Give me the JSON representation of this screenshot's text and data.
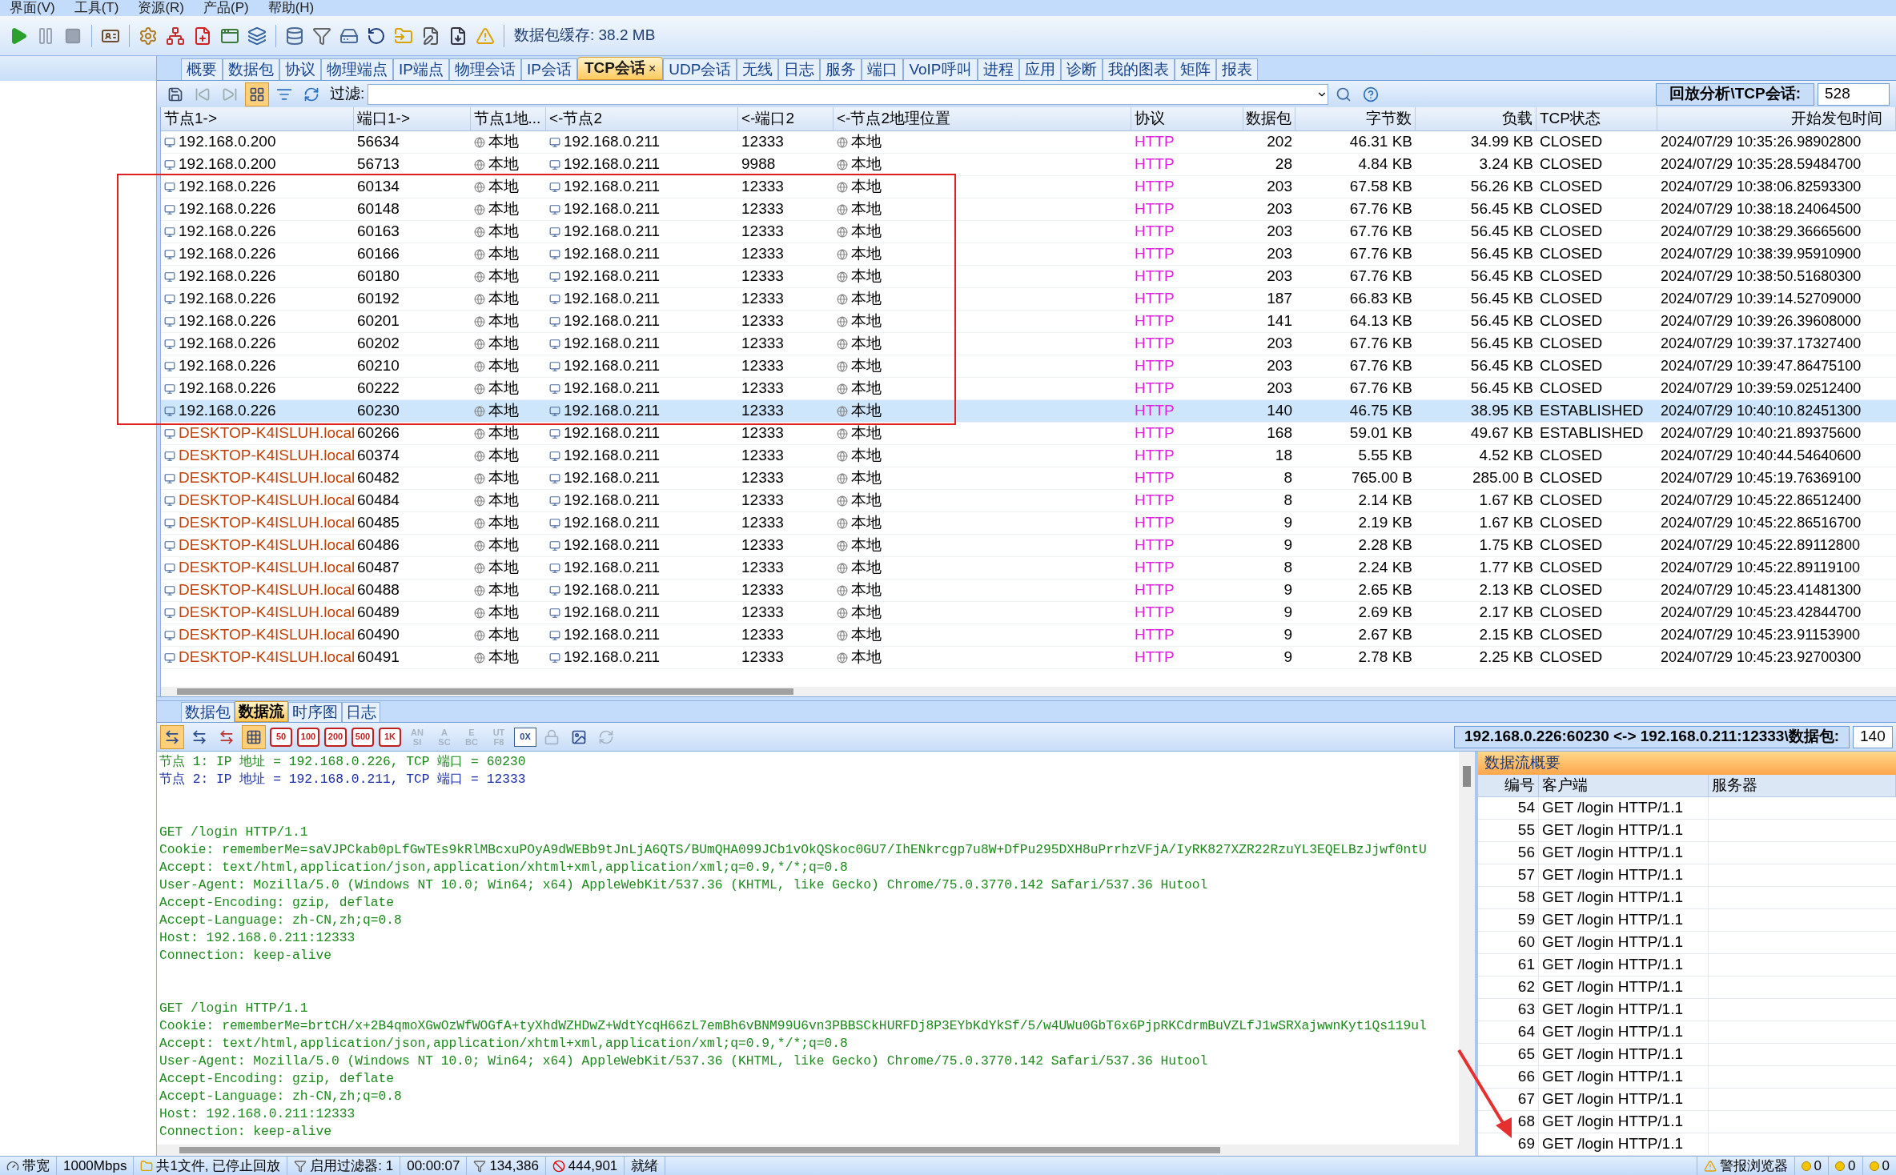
{
  "menu": [
    "界面(V)",
    "工具(T)",
    "资源(R)",
    "产品(P)",
    "帮助(H)"
  ],
  "toolbar": {
    "cache_label": "数据包缓存: 38.2 MB"
  },
  "tabs": [
    {
      "label": "概要",
      "selected": false
    },
    {
      "label": "数据包",
      "selected": false
    },
    {
      "label": "协议",
      "selected": false
    },
    {
      "label": "物理端点",
      "selected": false
    },
    {
      "label": "IP端点",
      "selected": false
    },
    {
      "label": "物理会话",
      "selected": false
    },
    {
      "label": "IP会话",
      "selected": false
    },
    {
      "label": "TCP会话",
      "selected": true,
      "close": "×"
    },
    {
      "label": "UDP会话",
      "selected": false
    },
    {
      "label": "无线",
      "selected": false
    },
    {
      "label": "日志",
      "selected": false
    },
    {
      "label": "服务",
      "selected": false
    },
    {
      "label": "端口",
      "selected": false
    },
    {
      "label": "VoIP呼叫",
      "selected": false
    },
    {
      "label": "进程",
      "selected": false
    },
    {
      "label": "应用",
      "selected": false
    },
    {
      "label": "诊断",
      "selected": false
    },
    {
      "label": "我的图表",
      "selected": false
    },
    {
      "label": "矩阵",
      "selected": false
    },
    {
      "label": "报表",
      "selected": false
    }
  ],
  "filter_bar": {
    "label": "过滤:",
    "path": "回放分析\\TCP会话:",
    "count": "528"
  },
  "table": {
    "columns": [
      "节点1->",
      "端口1->",
      "节点1地...",
      "<-节点2",
      "<-端口2",
      "<-节点2地理位置",
      "协议",
      "数据包",
      "字节数",
      "负载",
      "TCP状态",
      "开始发包时间"
    ],
    "rows": [
      {
        "selected": false,
        "color": "#000000",
        "cells": [
          "192.168.0.200",
          "56634",
          "本地",
          "192.168.0.211",
          "12333",
          "本地",
          "HTTP",
          "202",
          "46.31 KB",
          "34.99 KB",
          "CLOSED",
          "2024/07/29 10:35:26.98902800"
        ]
      },
      {
        "selected": false,
        "color": "#000000",
        "cells": [
          "192.168.0.200",
          "56713",
          "本地",
          "192.168.0.211",
          "9988",
          "本地",
          "HTTP",
          "28",
          "4.84 KB",
          "3.24 KB",
          "CLOSED",
          "2024/07/29 10:35:28.59484700"
        ]
      },
      {
        "selected": false,
        "color": "#000000",
        "cells": [
          "192.168.0.226",
          "60134",
          "本地",
          "192.168.0.211",
          "12333",
          "本地",
          "HTTP",
          "203",
          "67.58 KB",
          "56.26 KB",
          "CLOSED",
          "2024/07/29 10:38:06.82593300"
        ]
      },
      {
        "selected": false,
        "color": "#000000",
        "cells": [
          "192.168.0.226",
          "60148",
          "本地",
          "192.168.0.211",
          "12333",
          "本地",
          "HTTP",
          "203",
          "67.76 KB",
          "56.45 KB",
          "CLOSED",
          "2024/07/29 10:38:18.24064500"
        ]
      },
      {
        "selected": false,
        "color": "#000000",
        "cells": [
          "192.168.0.226",
          "60163",
          "本地",
          "192.168.0.211",
          "12333",
          "本地",
          "HTTP",
          "203",
          "67.76 KB",
          "56.45 KB",
          "CLOSED",
          "2024/07/29 10:38:29.36665600"
        ]
      },
      {
        "selected": false,
        "color": "#000000",
        "cells": [
          "192.168.0.226",
          "60166",
          "本地",
          "192.168.0.211",
          "12333",
          "本地",
          "HTTP",
          "203",
          "67.76 KB",
          "56.45 KB",
          "CLOSED",
          "2024/07/29 10:38:39.95910900"
        ]
      },
      {
        "selected": false,
        "color": "#000000",
        "cells": [
          "192.168.0.226",
          "60180",
          "本地",
          "192.168.0.211",
          "12333",
          "本地",
          "HTTP",
          "203",
          "67.76 KB",
          "56.45 KB",
          "CLOSED",
          "2024/07/29 10:38:50.51680300"
        ]
      },
      {
        "selected": false,
        "color": "#000000",
        "cells": [
          "192.168.0.226",
          "60192",
          "本地",
          "192.168.0.211",
          "12333",
          "本地",
          "HTTP",
          "187",
          "66.83 KB",
          "56.45 KB",
          "CLOSED",
          "2024/07/29 10:39:14.52709000"
        ]
      },
      {
        "selected": false,
        "color": "#000000",
        "cells": [
          "192.168.0.226",
          "60201",
          "本地",
          "192.168.0.211",
          "12333",
          "本地",
          "HTTP",
          "141",
          "64.13 KB",
          "56.45 KB",
          "CLOSED",
          "2024/07/29 10:39:26.39608000"
        ]
      },
      {
        "selected": false,
        "color": "#000000",
        "cells": [
          "192.168.0.226",
          "60202",
          "本地",
          "192.168.0.211",
          "12333",
          "本地",
          "HTTP",
          "203",
          "67.76 KB",
          "56.45 KB",
          "CLOSED",
          "2024/07/29 10:39:37.17327400"
        ]
      },
      {
        "selected": false,
        "color": "#000000",
        "cells": [
          "192.168.0.226",
          "60210",
          "本地",
          "192.168.0.211",
          "12333",
          "本地",
          "HTTP",
          "203",
          "67.76 KB",
          "56.45 KB",
          "CLOSED",
          "2024/07/29 10:39:47.86475100"
        ]
      },
      {
        "selected": false,
        "color": "#000000",
        "cells": [
          "192.168.0.226",
          "60222",
          "本地",
          "192.168.0.211",
          "12333",
          "本地",
          "HTTP",
          "203",
          "67.76 KB",
          "56.45 KB",
          "CLOSED",
          "2024/07/29 10:39:59.02512400"
        ]
      },
      {
        "selected": true,
        "color": "#000000",
        "cells": [
          "192.168.0.226",
          "60230",
          "本地",
          "192.168.0.211",
          "12333",
          "本地",
          "HTTP",
          "140",
          "46.75 KB",
          "38.95 KB",
          "ESTABLISHED",
          "2024/07/29 10:40:10.82451300"
        ]
      },
      {
        "selected": false,
        "color": "#c0400a",
        "cells": [
          "DESKTOP-K4ISLUH.local",
          "60266",
          "本地",
          "192.168.0.211",
          "12333",
          "本地",
          "HTTP",
          "168",
          "59.01 KB",
          "49.67 KB",
          "ESTABLISHED",
          "2024/07/29 10:40:21.89375600"
        ]
      },
      {
        "selected": false,
        "color": "#c0400a",
        "cells": [
          "DESKTOP-K4ISLUH.local",
          "60374",
          "本地",
          "192.168.0.211",
          "12333",
          "本地",
          "HTTP",
          "18",
          "5.55 KB",
          "4.52 KB",
          "CLOSED",
          "2024/07/29 10:40:44.54640600"
        ]
      },
      {
        "selected": false,
        "color": "#c0400a",
        "cells": [
          "DESKTOP-K4ISLUH.local",
          "60482",
          "本地",
          "192.168.0.211",
          "12333",
          "本地",
          "HTTP",
          "8",
          "765.00 B",
          "285.00 B",
          "CLOSED",
          "2024/07/29 10:45:19.76369100"
        ]
      },
      {
        "selected": false,
        "color": "#c0400a",
        "cells": [
          "DESKTOP-K4ISLUH.local",
          "60484",
          "本地",
          "192.168.0.211",
          "12333",
          "本地",
          "HTTP",
          "8",
          "2.14 KB",
          "1.67 KB",
          "CLOSED",
          "2024/07/29 10:45:22.86512400"
        ]
      },
      {
        "selected": false,
        "color": "#c0400a",
        "cells": [
          "DESKTOP-K4ISLUH.local",
          "60485",
          "本地",
          "192.168.0.211",
          "12333",
          "本地",
          "HTTP",
          "9",
          "2.19 KB",
          "1.67 KB",
          "CLOSED",
          "2024/07/29 10:45:22.86516700"
        ]
      },
      {
        "selected": false,
        "color": "#c0400a",
        "cells": [
          "DESKTOP-K4ISLUH.local",
          "60486",
          "本地",
          "192.168.0.211",
          "12333",
          "本地",
          "HTTP",
          "9",
          "2.28 KB",
          "1.75 KB",
          "CLOSED",
          "2024/07/29 10:45:22.89112800"
        ]
      },
      {
        "selected": false,
        "color": "#c0400a",
        "cells": [
          "DESKTOP-K4ISLUH.local",
          "60487",
          "本地",
          "192.168.0.211",
          "12333",
          "本地",
          "HTTP",
          "8",
          "2.24 KB",
          "1.77 KB",
          "CLOSED",
          "2024/07/29 10:45:22.89119100"
        ]
      },
      {
        "selected": false,
        "color": "#c0400a",
        "cells": [
          "DESKTOP-K4ISLUH.local",
          "60488",
          "本地",
          "192.168.0.211",
          "12333",
          "本地",
          "HTTP",
          "9",
          "2.65 KB",
          "2.13 KB",
          "CLOSED",
          "2024/07/29 10:45:23.41481300"
        ]
      },
      {
        "selected": false,
        "color": "#c0400a",
        "cells": [
          "DESKTOP-K4ISLUH.local",
          "60489",
          "本地",
          "192.168.0.211",
          "12333",
          "本地",
          "HTTP",
          "9",
          "2.69 KB",
          "2.17 KB",
          "CLOSED",
          "2024/07/29 10:45:23.42844700"
        ]
      },
      {
        "selected": false,
        "color": "#c0400a",
        "cells": [
          "DESKTOP-K4ISLUH.local",
          "60490",
          "本地",
          "192.168.0.211",
          "12333",
          "本地",
          "HTTP",
          "9",
          "2.67 KB",
          "2.15 KB",
          "CLOSED",
          "2024/07/29 10:45:23.91153900"
        ]
      },
      {
        "selected": false,
        "color": "#c0400a",
        "cells": [
          "DESKTOP-K4ISLUH.local",
          "60491",
          "本地",
          "192.168.0.211",
          "12333",
          "本地",
          "HTTP",
          "9",
          "2.78 KB",
          "2.25 KB",
          "CLOSED",
          "2024/07/29 10:45:23.92700300"
        ]
      }
    ]
  },
  "bottom_tabs": [
    {
      "label": "数据包",
      "selected": false
    },
    {
      "label": "数据流",
      "selected": true
    },
    {
      "label": "时序图",
      "selected": false
    },
    {
      "label": "日志",
      "selected": false
    }
  ],
  "stream_toolbar": {
    "sizes": [
      "50",
      "100",
      "200",
      "500",
      "1K"
    ],
    "encodings": [
      {
        "top": "AN",
        "bottom": "SI",
        "disabled": true
      },
      {
        "top": "A",
        "bottom": "SC",
        "disabled": true
      },
      {
        "top": "E",
        "bottom": "BC",
        "disabled": true
      },
      {
        "top": "UT",
        "bottom": "F8",
        "disabled": true
      }
    ],
    "hex": "0X"
  },
  "connection": {
    "label": "192.168.0.226:60230 <-> 192.168.0.211:12333\\数据包:",
    "value": "140"
  },
  "stream_lines": [
    {
      "kind": "text",
      "color": "#1e8a1e",
      "text": "节点 1: IP 地址 = 192.168.0.226, TCP 端口 = 60230"
    },
    {
      "kind": "text",
      "color": "#1c2ea8",
      "text": "节点 2: IP 地址 = 192.168.0.211, TCP 端口 = 12333"
    },
    {
      "kind": "blank"
    },
    {
      "kind": "blank"
    },
    {
      "kind": "text",
      "color": "#1e8a1e",
      "text": "GET /login HTTP/1.1"
    },
    {
      "kind": "text",
      "color": "#1e8a1e",
      "text": "Cookie: rememberMe=saVJPCkab0pLfGwTEs9kRlMBcxuPOyA9dWEBb9tJnLjA6QTS/BUmQHA099JCb1vOkQSkoc0GU7/IhENkrcgp7u8W+DfPu295DXH8uPrrhzVFjA/IyRK827XZR22RzuYL3EQELBzJjwf0ntU"
    },
    {
      "kind": "text",
      "color": "#1e8a1e",
      "text": "Accept: text/html,application/json,application/xhtml+xml,application/xml;q=0.9,*/*;q=0.8"
    },
    {
      "kind": "text",
      "color": "#1e8a1e",
      "text": "User-Agent: Mozilla/5.0 (Windows NT 10.0; Win64; x64) AppleWebKit/537.36 (KHTML, like Gecko) Chrome/75.0.3770.142 Safari/537.36 Hutool"
    },
    {
      "kind": "text",
      "color": "#1e8a1e",
      "text": "Accept-Encoding: gzip, deflate"
    },
    {
      "kind": "text",
      "color": "#1e8a1e",
      "text": "Accept-Language: zh-CN,zh;q=0.8"
    },
    {
      "kind": "text",
      "color": "#1e8a1e",
      "text": "Host: 192.168.0.211:12333"
    },
    {
      "kind": "text",
      "color": "#1e8a1e",
      "text": "Connection: keep-alive"
    },
    {
      "kind": "blank"
    },
    {
      "kind": "blank"
    },
    {
      "kind": "text",
      "color": "#1e8a1e",
      "text": "GET /login HTTP/1.1"
    },
    {
      "kind": "text",
      "color": "#1e8a1e",
      "text": "Cookie: rememberMe=brtCH/x+2B4qmoXGwOzWfWOGfA+tyXhdWZHDwZ+WdtYcqH66zL7emBh6vBNM99U6vn3PBBSCkHURFDj8P3EYbKdYkSf/5/w4UWu0GbT6x6PjpRKCdrmBuVZLfJ1wSRXajwwnKyt1Qs119ul"
    },
    {
      "kind": "text",
      "color": "#1e8a1e",
      "text": "Accept: text/html,application/json,application/xhtml+xml,application/xml;q=0.9,*/*;q=0.8"
    },
    {
      "kind": "text",
      "color": "#1e8a1e",
      "text": "User-Agent: Mozilla/5.0 (Windows NT 10.0; Win64; x64) AppleWebKit/537.36 (KHTML, like Gecko) Chrome/75.0.3770.142 Safari/537.36 Hutool"
    },
    {
      "kind": "text",
      "color": "#1e8a1e",
      "text": "Accept-Encoding: gzip, deflate"
    },
    {
      "kind": "text",
      "color": "#1e8a1e",
      "text": "Accept-Language: zh-CN,zh;q=0.8"
    },
    {
      "kind": "text",
      "color": "#1e8a1e",
      "text": "Host: 192.168.0.211:12333"
    },
    {
      "kind": "text",
      "color": "#1e8a1e",
      "text": "Connection: keep-alive"
    }
  ],
  "summary": {
    "title": "数据流概要",
    "columns": [
      "编号",
      "客户端",
      "服务器"
    ],
    "rows": [
      {
        "id": "54",
        "client": "GET /login HTTP/1.1"
      },
      {
        "id": "55",
        "client": "GET /login HTTP/1.1"
      },
      {
        "id": "56",
        "client": "GET /login HTTP/1.1"
      },
      {
        "id": "57",
        "client": "GET /login HTTP/1.1"
      },
      {
        "id": "58",
        "client": "GET /login HTTP/1.1"
      },
      {
        "id": "59",
        "client": "GET /login HTTP/1.1"
      },
      {
        "id": "60",
        "client": "GET /login HTTP/1.1"
      },
      {
        "id": "61",
        "client": "GET /login HTTP/1.1"
      },
      {
        "id": "62",
        "client": "GET /login HTTP/1.1"
      },
      {
        "id": "63",
        "client": "GET /login HTTP/1.1"
      },
      {
        "id": "64",
        "client": "GET /login HTTP/1.1"
      },
      {
        "id": "65",
        "client": "GET /login HTTP/1.1"
      },
      {
        "id": "66",
        "client": "GET /login HTTP/1.1"
      },
      {
        "id": "67",
        "client": "GET /login HTTP/1.1"
      },
      {
        "id": "68",
        "client": "GET /login HTTP/1.1"
      },
      {
        "id": "69",
        "client": "GET /login HTTP/1.1"
      }
    ]
  },
  "status_bar": {
    "left": [
      {
        "kind": "bandwidth",
        "text": "带宽"
      },
      {
        "kind": "plain",
        "text": "1000Mbps"
      },
      {
        "kind": "file",
        "text": "共1文件, 已停止回放"
      },
      {
        "kind": "filter",
        "text": "启用过滤器: 1"
      },
      {
        "kind": "plain",
        "text": "00:00:07"
      },
      {
        "kind": "filter",
        "text": "134,386"
      },
      {
        "kind": "blocked",
        "text": "444,901"
      },
      {
        "kind": "plain",
        "text": "就绪"
      }
    ],
    "right": [
      {
        "kind": "alert",
        "text": "警报浏览器"
      },
      {
        "kind": "dot",
        "text": "0"
      },
      {
        "kind": "dot",
        "text": "0"
      },
      {
        "kind": "dot",
        "text": "0"
      }
    ]
  }
}
